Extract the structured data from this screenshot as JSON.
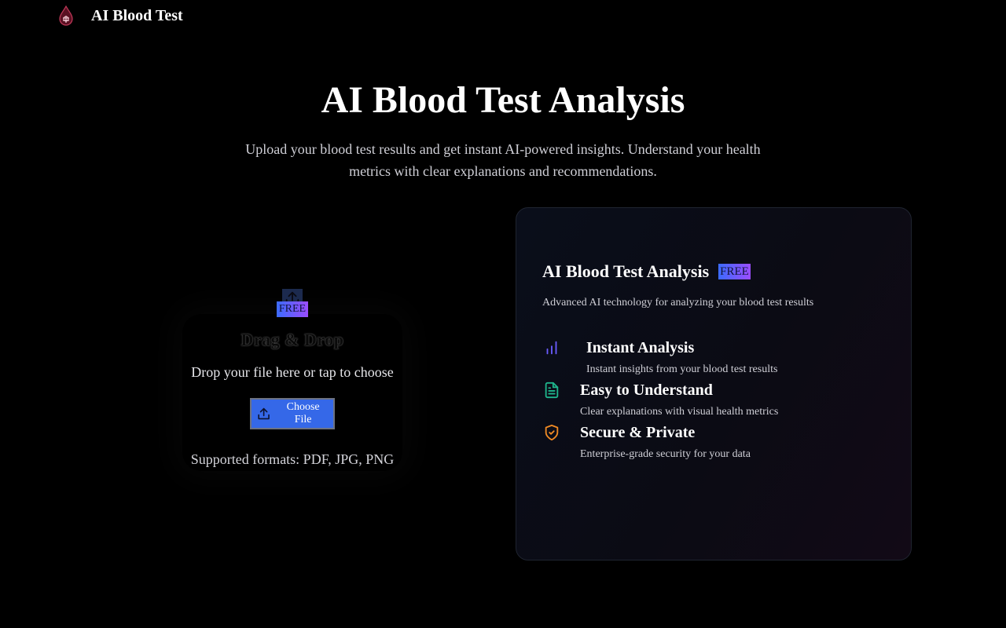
{
  "header": {
    "brand": "AI Blood Test",
    "logo_icon": "blood-drop-logo-icon"
  },
  "hero": {
    "title": "AI Blood Test Analysis",
    "subtitle": "Upload your blood test results and get instant AI-powered insights. Understand your health metrics with clear explanations and recommendations."
  },
  "upload": {
    "icon": "upload-icon",
    "badge": "FREE",
    "title": "Drag & Drop",
    "drop_text": "Drop your file here or tap to choose",
    "button_label": "Choose File",
    "formats": "Supported formats: PDF, JPG, PNG"
  },
  "card": {
    "title": "AI Blood Test Analysis",
    "badge": "FREE",
    "subtitle": "Advanced AI technology for analyzing your blood test results",
    "features": [
      {
        "icon": "bar-chart-icon",
        "color": "#6a5cff",
        "title": "Instant Analysis",
        "desc": "Instant insights from your blood test results"
      },
      {
        "icon": "document-icon",
        "color": "#1fb58c",
        "title": "Easy to Understand",
        "desc": "Clear explanations with visual health metrics"
      },
      {
        "icon": "shield-check-icon",
        "color": "#f08a24",
        "title": "Secure & Private",
        "desc": "Enterprise-grade security for your data"
      }
    ]
  },
  "colors": {
    "background": "#000000",
    "accent_blue": "#3568e8",
    "badge_gradient_start": "#3b6bff",
    "badge_gradient_end": "#9b4dff"
  }
}
